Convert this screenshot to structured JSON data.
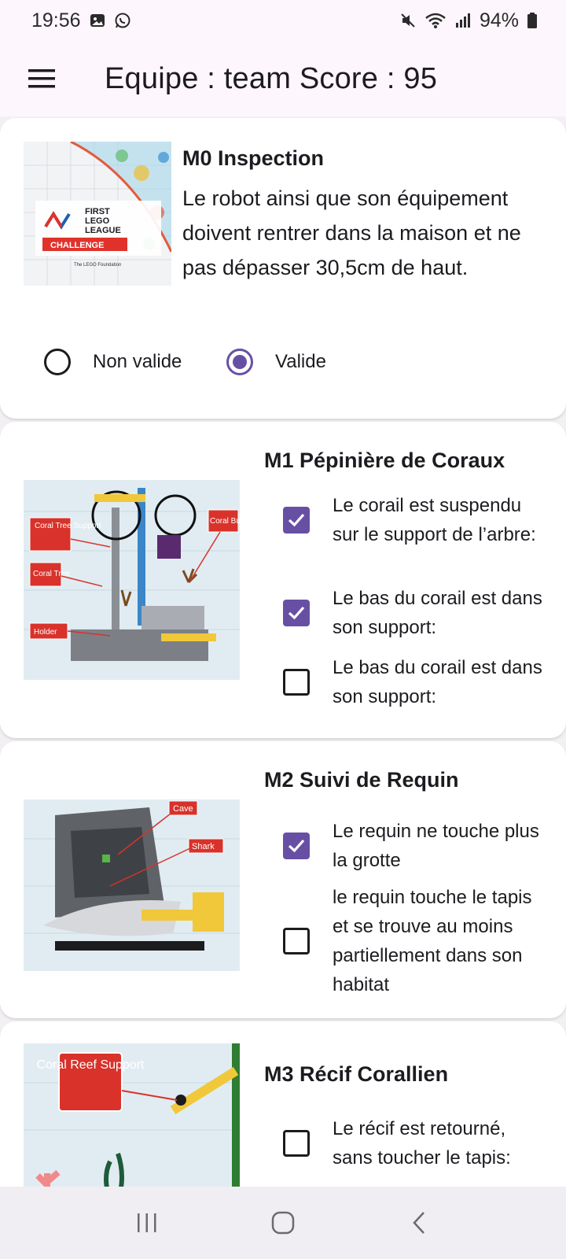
{
  "status_bar": {
    "time": "19:56",
    "left_icons": [
      "gallery-icon",
      "whatsapp-icon"
    ],
    "right_icons": [
      "mute-icon",
      "wifi-icon",
      "signal-icon"
    ],
    "battery": "94%"
  },
  "app_bar": {
    "menu_icon": "hamburger-menu-icon",
    "title": "Equipe : team Score : 95"
  },
  "missions": [
    {
      "title": "M0 Inspection",
      "description": "Le robot ainsi que son équipement doivent rentrer dans la maison et ne pas dépasser 30,5cm de haut.",
      "image_text": {
        "first": "FIRST",
        "lego": "LEGO",
        "league": "LEAGUE",
        "challenge": "CHALLENGE",
        "footer": "The LEGO Foundation"
      },
      "options": [
        {
          "label": "Non valide",
          "selected": false
        },
        {
          "label": "Valide",
          "selected": true
        }
      ]
    },
    {
      "title": "M1 Pépinière de Coraux",
      "image_labels": [
        "Coral Tree Support",
        "Coral Tree",
        "Holder",
        "Coral Buds"
      ],
      "checks": [
        {
          "label": "Le corail est suspendu sur le support de l’arbre:",
          "checked": true
        },
        {
          "label": "Le bas du corail est dans son support:",
          "checked": true
        },
        {
          "label": "Le bas du corail est dans son support:",
          "checked": false
        }
      ]
    },
    {
      "title": "M2 Suivi de Requin",
      "image_labels": [
        "Cave",
        "Shark"
      ],
      "checks": [
        {
          "label": "Le requin ne touche plus la grotte",
          "checked": true
        },
        {
          "label": "le requin touche le tapis et se trouve au moins partiellement dans son habitat",
          "checked": false
        }
      ]
    },
    {
      "title": "M3 Récif Corallien",
      "image_labels": [
        "Coral Reef Support"
      ],
      "checks": [
        {
          "label": "Le récif est retourné, sans toucher le tapis:",
          "checked": false
        }
      ]
    }
  ],
  "nav_bar": {
    "icons": [
      "recent-apps-icon",
      "home-icon",
      "back-icon"
    ]
  },
  "colors": {
    "accent": "#6750a4",
    "app_bar_bg": "#fdf6fc",
    "page_bg": "#f3f0f4",
    "card_bg": "#ffffff"
  }
}
